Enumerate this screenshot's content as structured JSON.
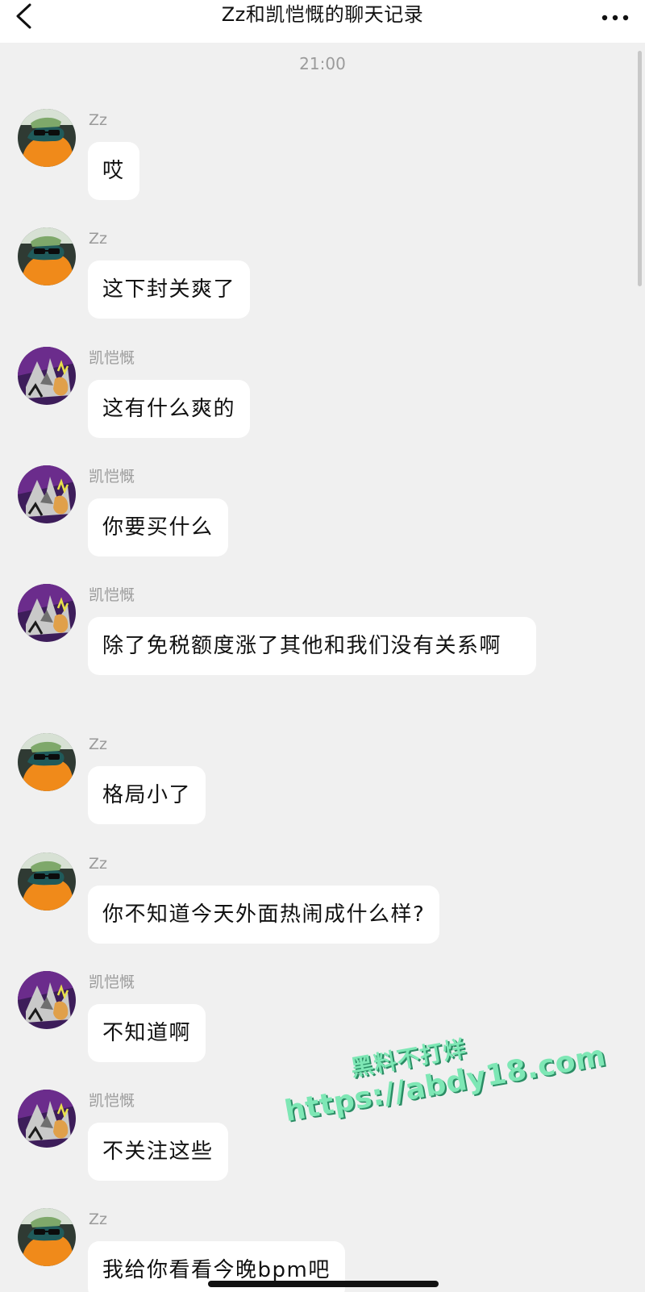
{
  "header": {
    "title": "Zz和凯恺慨的聊天记录",
    "back_icon": "chevron-left-icon",
    "more_icon": "ellipsis-icon"
  },
  "chat": {
    "timestamp": "21:00",
    "messages": [
      {
        "sender": "Zz",
        "avatar": "zz-avatar",
        "text": "哎"
      },
      {
        "sender": "Zz",
        "avatar": "zz-avatar",
        "text": "这下封关爽了"
      },
      {
        "sender": "凯恺慨",
        "avatar": "kai-avatar",
        "text": "这有什么爽的"
      },
      {
        "sender": "凯恺慨",
        "avatar": "kai-avatar",
        "text": "你要买什么"
      },
      {
        "sender": "凯恺慨",
        "avatar": "kai-avatar",
        "text": "除了免税额度涨了其他和我们没有关系啊"
      },
      {
        "sender": "Zz",
        "avatar": "zz-avatar",
        "text": "格局小了"
      },
      {
        "sender": "Zz",
        "avatar": "zz-avatar",
        "text": "你不知道今天外面热闹成什么样?"
      },
      {
        "sender": "凯恺慨",
        "avatar": "kai-avatar",
        "text": "不知道啊"
      },
      {
        "sender": "凯恺慨",
        "avatar": "kai-avatar",
        "text": "不关注这些"
      },
      {
        "sender": "Zz",
        "avatar": "zz-avatar",
        "text": "我给你看看今晚bpm吧"
      }
    ]
  },
  "watermark": {
    "line1": "黑料不打烊",
    "line2": "https://abdy18.com"
  },
  "colors": {
    "background": "#f0f0f0",
    "bubble": "#ffffff",
    "watermark": "#7ee7b5"
  }
}
